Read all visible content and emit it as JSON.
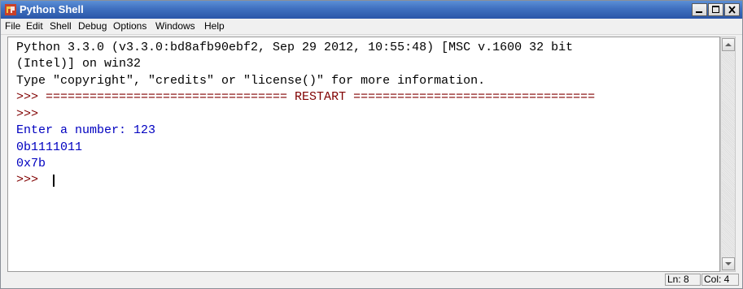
{
  "window": {
    "title": "Python Shell",
    "accent_color": "#3f6fbf",
    "icon": "python-app-icon"
  },
  "menu": {
    "items": [
      "File",
      "Edit",
      "Shell",
      "Debug",
      "Options",
      "Windows",
      "Help"
    ]
  },
  "shell": {
    "lines": [
      {
        "text": "Python 3.3.0 (v3.3.0:bd8afb90ebf2, Sep 29 2012, 10:55:48) [MSC v.1600 32 bit",
        "kind": "output"
      },
      {
        "text": "(Intel)] on win32",
        "kind": "output"
      },
      {
        "text": "Type \"copyright\", \"credits\" or \"license()\" for more information.",
        "kind": "output"
      },
      {
        "text": ">>> ================================= RESTART =================================",
        "kind": "prompt"
      },
      {
        "text": ">>>",
        "kind": "prompt"
      },
      {
        "text": "Enter a number: 123",
        "kind": "stdout"
      },
      {
        "text": "0b1111011",
        "kind": "stdout"
      },
      {
        "text": "0x7b",
        "kind": "stdout"
      },
      {
        "text": ">>> ",
        "kind": "prompt"
      }
    ],
    "colors": {
      "output": "#000000",
      "stdout": "#0000c0",
      "prompt": "#800000"
    }
  },
  "status": {
    "line": "Ln: 8",
    "col": "Col: 4"
  }
}
